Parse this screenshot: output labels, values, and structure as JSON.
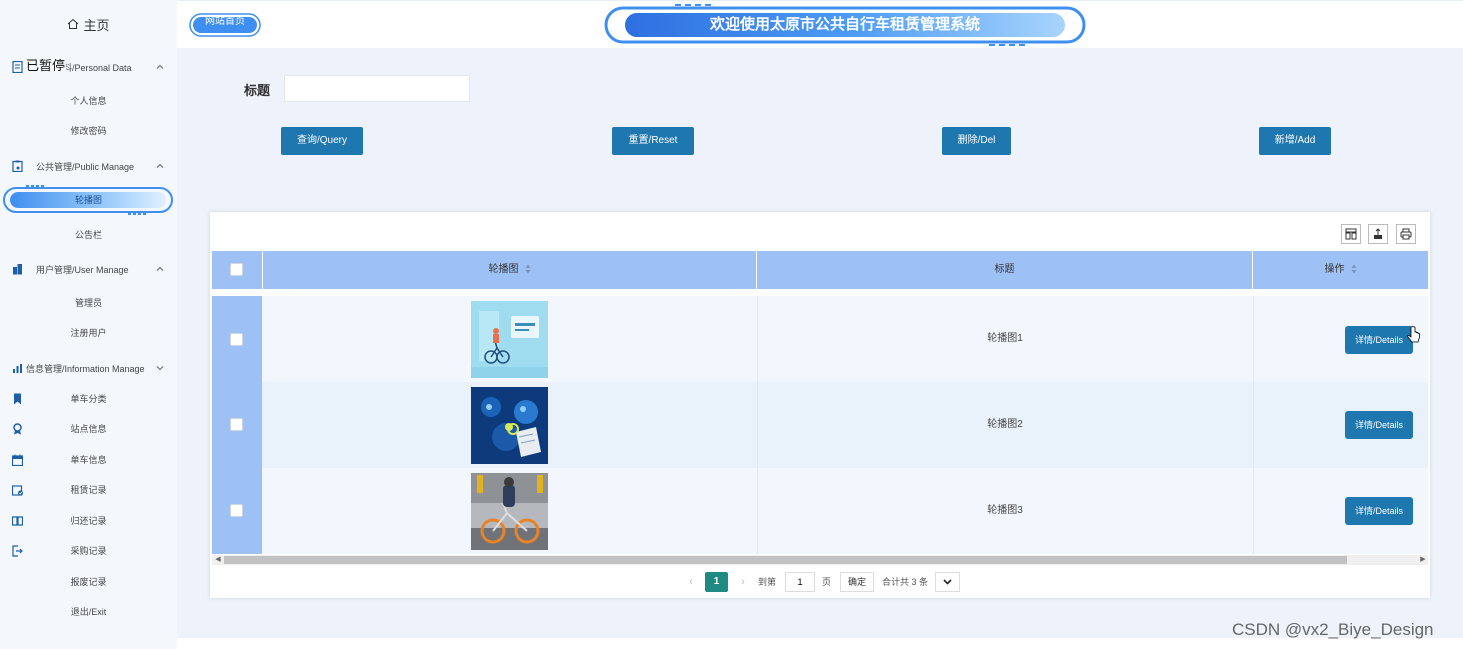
{
  "sidebar": {
    "home": "主页",
    "overlay_tag": "已暂停",
    "groups": {
      "personal": {
        "label": "个人资料/Personal Data",
        "items": [
          "个人信息",
          "修改密码"
        ]
      },
      "public": {
        "label": "公共管理/Public Manage",
        "items": [
          "轮播图",
          "公告栏"
        ]
      },
      "user": {
        "label": "用户管理/User Manage",
        "items": [
          "管理员",
          "注册用户"
        ]
      },
      "info": {
        "label": "信息管理/Information Manage",
        "items": [
          "单车分类",
          "站点信息",
          "单车信息",
          "租赁记录",
          "归还记录",
          "采购记录",
          "报废记录"
        ]
      }
    },
    "exit": "退出/Exit",
    "active_item": "轮播图"
  },
  "header": {
    "logo_text": "网站首页",
    "banner_title": "欢迎使用太原市公共自行车租赁管理系统"
  },
  "search": {
    "label": "标题",
    "value": ""
  },
  "buttons": {
    "query": "查询/Query",
    "reset": "重置/Reset",
    "delete": "删除/Del",
    "add": "新增/Add"
  },
  "table": {
    "columns": [
      "轮播图",
      "标题",
      "操作"
    ],
    "rows": [
      {
        "title": "轮播图1",
        "action": "详情/Details"
      },
      {
        "title": "轮播图2",
        "action": "详情/Details"
      },
      {
        "title": "轮播图3",
        "action": "详情/Details"
      }
    ]
  },
  "pagination": {
    "current": "1",
    "goto_label": "到第",
    "goto_value": "1",
    "page_unit": "页",
    "confirm": "确定",
    "total": "合计共 3 条"
  },
  "watermark": "CSDN @vx2_Biye_Design",
  "colors": {
    "primary_button": "#1f77b0",
    "table_header": "#9ec1f5",
    "main_bg": "#edf2fb",
    "pager_active": "#1f8a82"
  }
}
